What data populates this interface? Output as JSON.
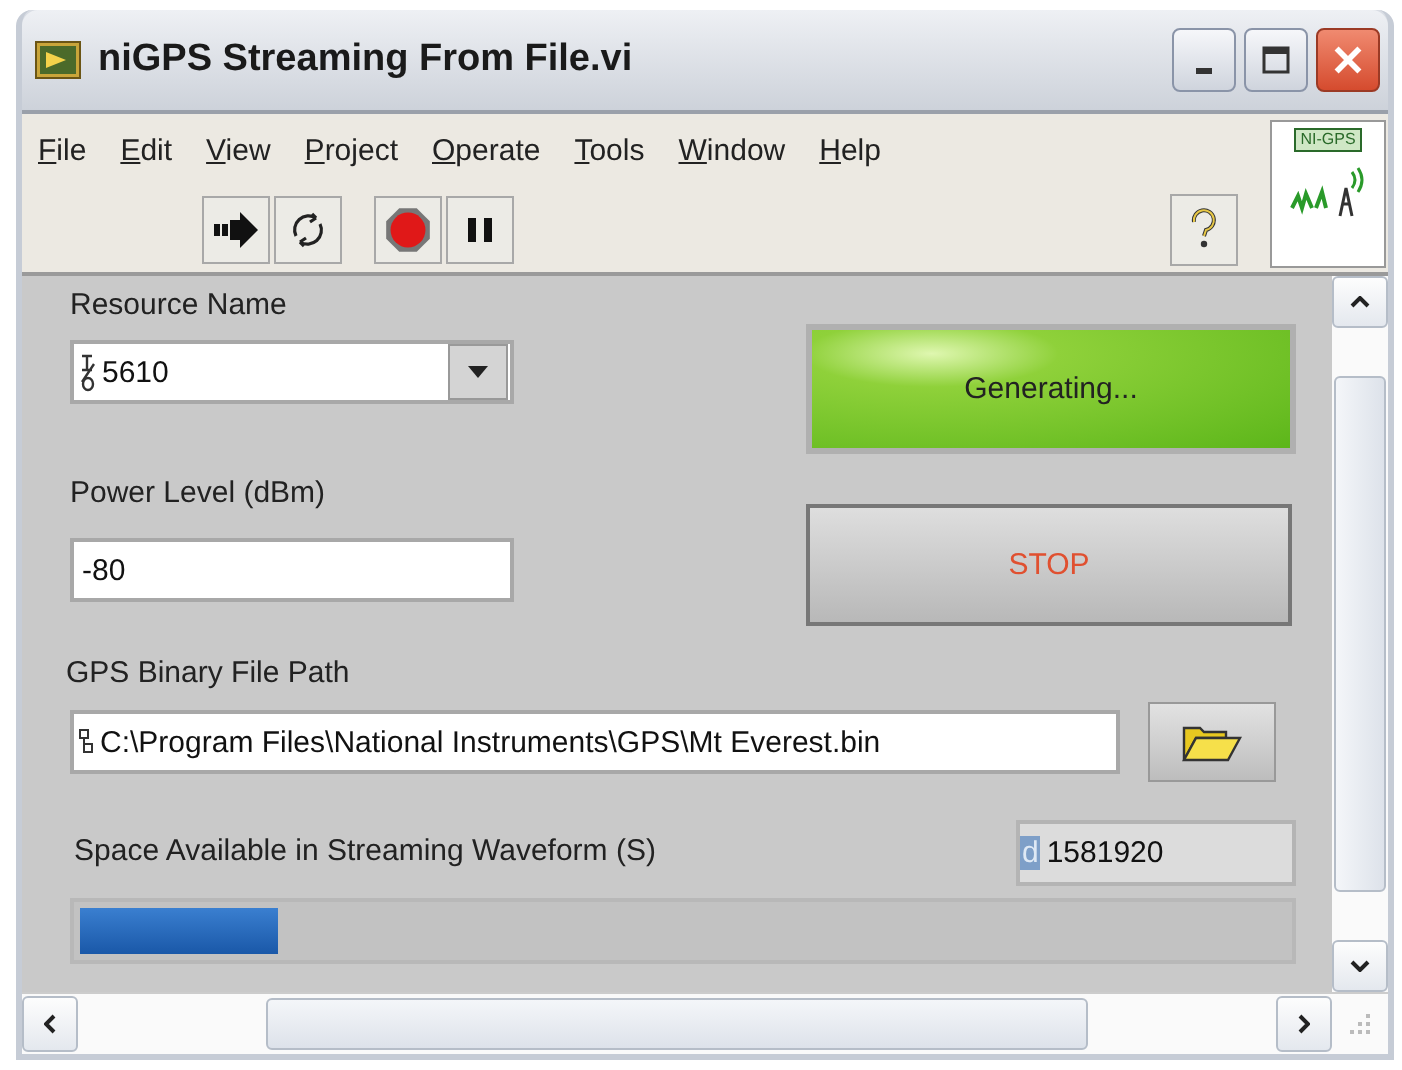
{
  "window": {
    "title": "niGPS Streaming From File.vi"
  },
  "menu": [
    "File",
    "Edit",
    "View",
    "Project",
    "Operate",
    "Tools",
    "Window",
    "Help"
  ],
  "vi_icon": {
    "label": "NI-GPS"
  },
  "toolbar": {
    "running": true,
    "paused": false
  },
  "resource": {
    "label": "Resource Name",
    "value": "5610"
  },
  "status": {
    "text": "Generating...",
    "on": true
  },
  "power": {
    "label": "Power Level (dBm)",
    "value": "-80"
  },
  "stop": {
    "label": "STOP"
  },
  "path": {
    "label": "GPS Binary File Path",
    "value": "C:\\Program Files\\National Instruments\\GPS\\Mt Everest.bin"
  },
  "space": {
    "label": "Space Available in Streaming Waveform (S)",
    "radix": "d",
    "value": "1581920",
    "level": 0.165
  }
}
